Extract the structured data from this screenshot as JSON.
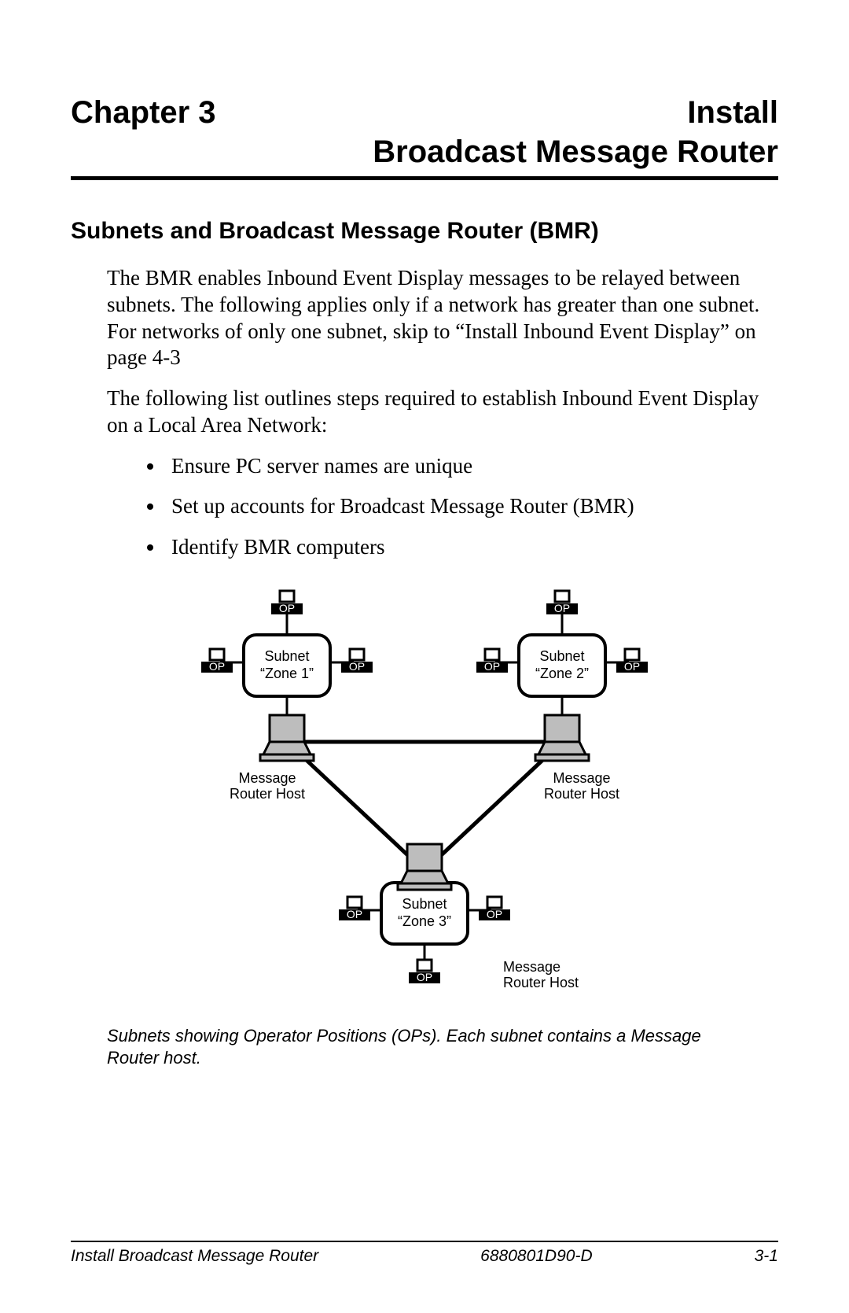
{
  "header": {
    "chapter_label": "Chapter 3",
    "title_word1": "Install",
    "title_line2": "Broadcast Message Router"
  },
  "section": {
    "heading": "Subnets and Broadcast Message Router (BMR)",
    "para1": "The BMR enables Inbound Event Display messages to be relayed between subnets.  The following applies only if a network has greater than one subnet.  For networks of only one subnet, skip to “Install Inbound Event Display” on page 4-3",
    "para2": "The following list outlines steps required to establish Inbound Event Display on a Local Area Network:",
    "bullets": [
      "Ensure PC server names are unique",
      "Set up accounts for Broadcast Message Router (BMR)",
      "Identify BMR computers"
    ]
  },
  "diagram": {
    "op_label": "OP",
    "zone1_line1": "Subnet",
    "zone1_line2": "“Zone 1”",
    "zone2_line1": "Subnet",
    "zone2_line2": "“Zone 2”",
    "zone3_line1": "Subnet",
    "zone3_line2": "“Zone 3”",
    "host_label_line1": "Message",
    "host_label_line2": "Router Host"
  },
  "caption": "Subnets showing Operator Positions (OPs).  Each subnet contains a Message Router host.",
  "footer": {
    "left": "Install Broadcast Message Router",
    "center": "6880801D90-D",
    "right": "3-1"
  }
}
